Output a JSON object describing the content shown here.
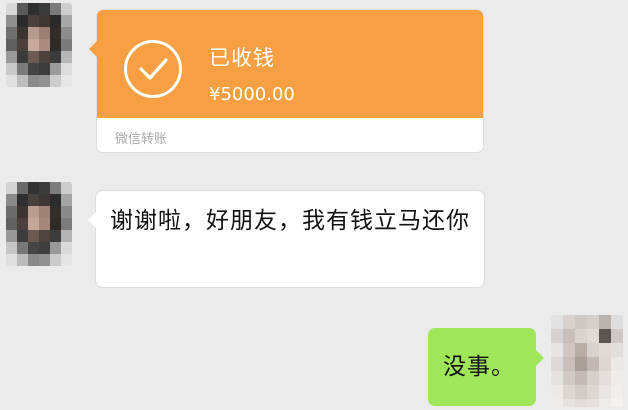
{
  "messages": [
    {
      "sender": "contact",
      "type": "transfer",
      "status": "已收钱",
      "amount": "¥5000.00",
      "source": "微信转账"
    },
    {
      "sender": "contact",
      "type": "text",
      "text": "谢谢啦，好朋友，我有钱立马还你"
    },
    {
      "sender": "self",
      "type": "text",
      "text": "没事。"
    }
  ],
  "colors": {
    "background": "#ebebeb",
    "transfer_orange": "#f7a043",
    "incoming_bubble": "#ffffff",
    "outgoing_bubble": "#9fe65b"
  }
}
